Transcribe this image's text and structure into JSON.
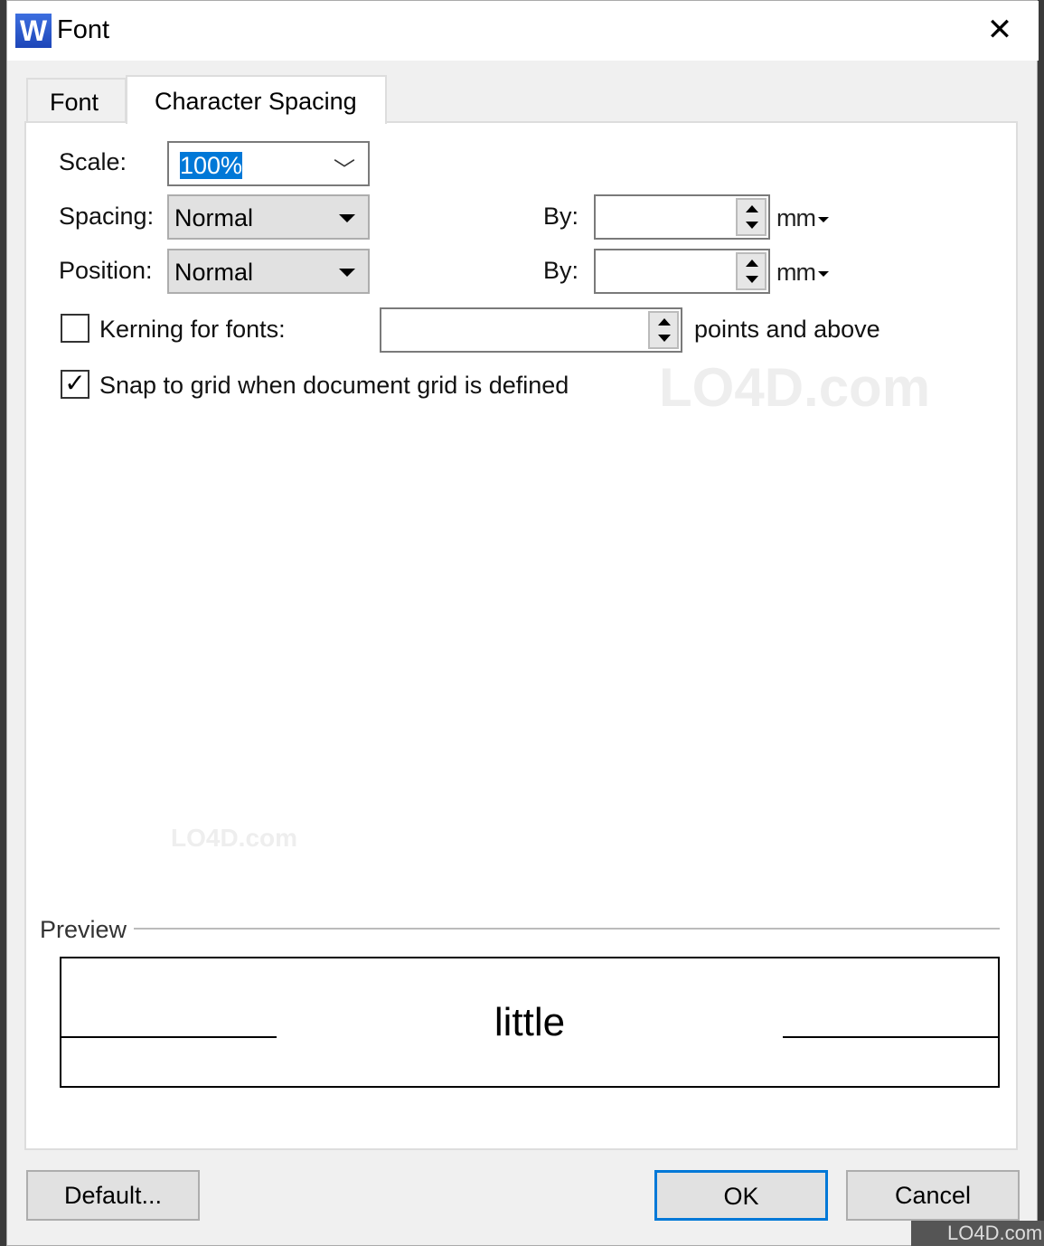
{
  "window": {
    "title": "Font",
    "icon": "wps-writer-icon",
    "close_icon": "close-icon"
  },
  "tabs": [
    {
      "label": "Font",
      "active": false
    },
    {
      "label": "Character Spacing",
      "active": true
    }
  ],
  "scale": {
    "label": "Scale:",
    "value": "100%"
  },
  "spacing": {
    "label": "Spacing:",
    "value": "Normal",
    "by_label": "By:",
    "by_value": "",
    "unit": "mm"
  },
  "position": {
    "label": "Position:",
    "value": "Normal",
    "by_label": "By:",
    "by_value": "",
    "unit": "mm"
  },
  "kerning": {
    "label": "Kerning for fonts:",
    "checked": false,
    "value": "",
    "suffix": "points and above"
  },
  "snap": {
    "label": "Snap to grid when document grid is defined",
    "checked": true
  },
  "preview": {
    "label": "Preview",
    "text": "little"
  },
  "buttons": {
    "default": "Default...",
    "ok": "OK",
    "cancel": "Cancel"
  },
  "watermark": "LO4D.com",
  "colors": {
    "accent": "#0078d7"
  }
}
